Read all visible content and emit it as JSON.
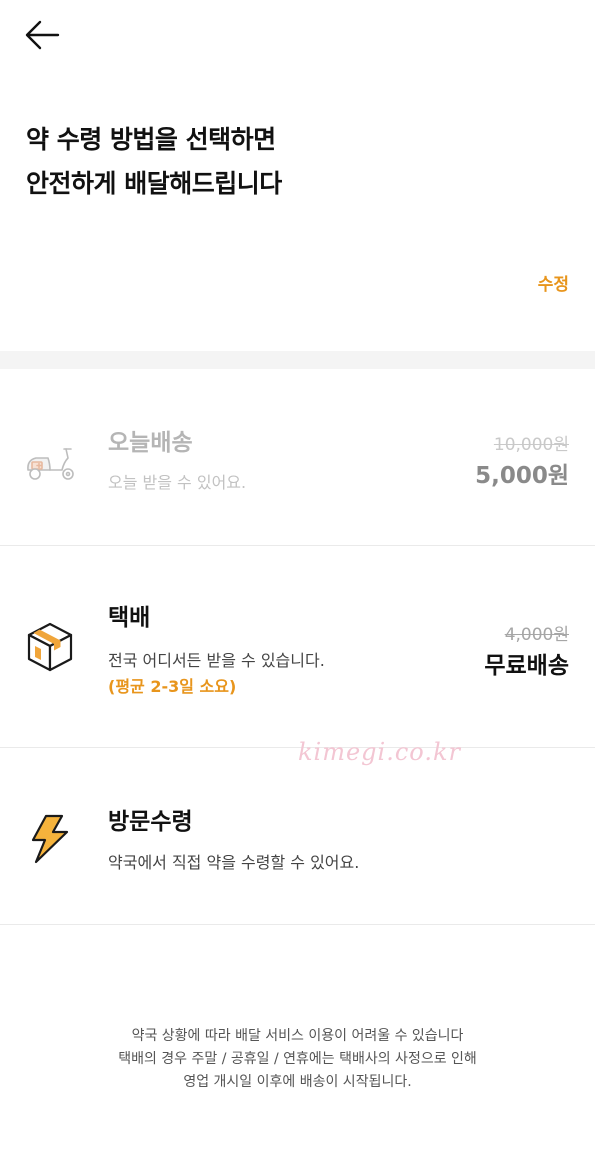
{
  "header": {
    "back_icon": "arrow-left-icon",
    "title_line1": "약 수령 방법을 선택하면",
    "title_line2": "안전하게 배달해드립니다",
    "edit_label": "수정"
  },
  "options": [
    {
      "icon": "scooter-icon",
      "name": "오늘배송",
      "description": "오늘 받을 수 있어요.",
      "original_price": "10,000원",
      "price": "5,000원",
      "disabled": true
    },
    {
      "icon": "package-box-icon",
      "name": "택배",
      "description": "전국 어디서든 받을 수 있습니다.",
      "note": "(평균 2-3일 소요)",
      "original_price": "4,000원",
      "price": "무료배송"
    },
    {
      "icon": "lightning-icon",
      "name": "방문수령",
      "description": "약국에서 직접 약을 수령할 수 있어요."
    }
  ],
  "watermark": "kimegi.co.kr",
  "footer": {
    "line1": "약국 상황에 따라 배달 서비스 이용이 어려울 수 있습니다",
    "line2": "택배의 경우 주말 / 공휴일 / 연휴에는 택배사의 사정으로 인해",
    "line3": "영업 개시일 이후에 배송이 시작됩니다."
  },
  "colors": {
    "accent": "#e8951c",
    "section_gap": "#f4f4f4",
    "disabled_text": "#b5b5b5"
  }
}
